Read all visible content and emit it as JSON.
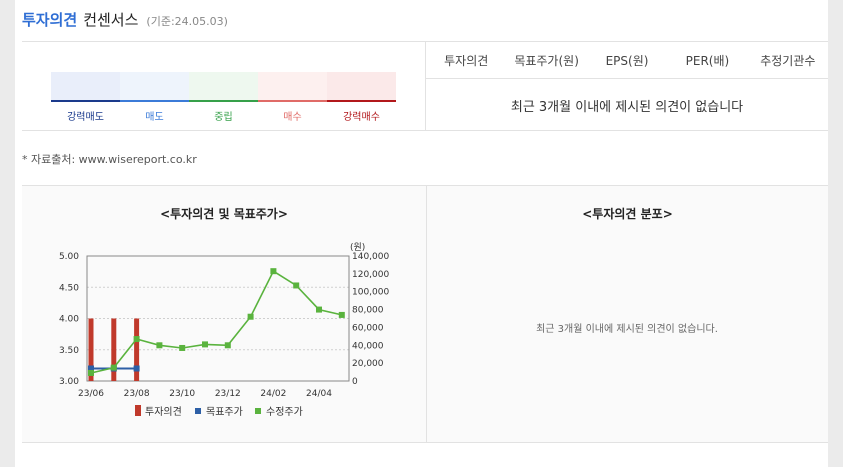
{
  "header": {
    "title": "투자의견",
    "title2": "컨센서스",
    "date": "(기준:24.05.03)"
  },
  "scale": [
    {
      "label": "강력매도",
      "color": "#1a3a8c",
      "bg": "#e9eefa"
    },
    {
      "label": "매도",
      "color": "#3b7bd8",
      "bg": "#eef4fc"
    },
    {
      "label": "중립",
      "color": "#36a04a",
      "bg": "#eef8ef"
    },
    {
      "label": "매수",
      "color": "#e06b67",
      "bg": "#fdf0ef"
    },
    {
      "label": "강력매수",
      "color": "#b2181b",
      "bg": "#fbe9e9"
    }
  ],
  "table": {
    "columns": [
      "투자의견",
      "목표주가(원)",
      "EPS(원)",
      "PER(배)",
      "추정기관수"
    ],
    "empty": "최근 3개월 이내에 제시된 의견이 없습니다"
  },
  "source": "* 자료출처: www.wisereport.co.kr",
  "left_panel": {
    "title": "<투자의견 및 목표주가>"
  },
  "right_panel": {
    "title": "<투자의견 분포>",
    "empty": "최근 3개월 이내에 제시된 의견이 없습니다."
  },
  "chart_data": {
    "type": "bar+line",
    "x_ticks": [
      "23/06",
      "23/08",
      "23/10",
      "23/12",
      "24/02",
      "24/04"
    ],
    "y_left_ticks": [
      "5.00",
      "4.50",
      "4.00",
      "3.50",
      "3.00"
    ],
    "y_left_range": [
      3.0,
      5.0
    ],
    "y_right_ticks": [
      "140,000",
      "120,000",
      "100,000",
      "80,000",
      "60,000",
      "40,000",
      "20,000",
      "0"
    ],
    "y_right_range": [
      0,
      140000
    ],
    "y_right_unit": "(원)",
    "months": [
      "23/06",
      "23/07",
      "23/08",
      "23/09",
      "23/10",
      "23/11",
      "23/12",
      "24/01",
      "24/02",
      "24/03",
      "24/04",
      "24/05"
    ],
    "series": [
      {
        "name": "투자의견",
        "kind": "bar",
        "axis": "left",
        "color": "#c0392b",
        "points": [
          [
            "23/06",
            4.0
          ],
          [
            "23/07",
            4.0
          ],
          [
            "23/08",
            4.0
          ]
        ]
      },
      {
        "name": "목표주가",
        "kind": "line",
        "axis": "right",
        "color": "#2d5fa6",
        "points": [
          [
            "23/06",
            14000
          ],
          [
            "23/07",
            14000
          ],
          [
            "23/08",
            14000
          ]
        ]
      },
      {
        "name": "수정주가",
        "kind": "line",
        "axis": "right",
        "color": "#5ab33e",
        "points": [
          [
            "23/06",
            9000
          ],
          [
            "23/07",
            15000
          ],
          [
            "23/08",
            47000
          ],
          [
            "23/09",
            40000
          ],
          [
            "23/10",
            37000
          ],
          [
            "23/11",
            41000
          ],
          [
            "23/12",
            40000
          ],
          [
            "24/01",
            72000
          ],
          [
            "24/02",
            123000
          ],
          [
            "24/03",
            107000
          ],
          [
            "24/04",
            80000
          ],
          [
            "24/05",
            74000
          ]
        ]
      }
    ]
  }
}
